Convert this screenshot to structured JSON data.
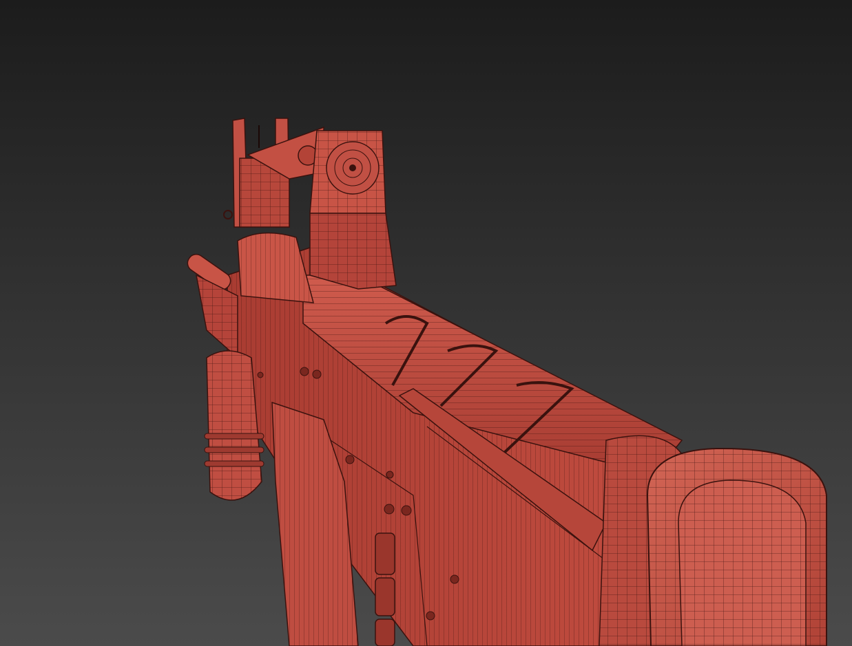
{
  "scene": {
    "description_visible_text": "",
    "colors": {
      "background_top": "#1e1e1e",
      "background_bottom": "#4a4a4a",
      "model_base": "#b8453a",
      "model_light": "#cf5a4c",
      "model_dark": "#8a2f27",
      "wire": "#3a120e"
    },
    "render_style": "wireframe-on-shaded"
  }
}
